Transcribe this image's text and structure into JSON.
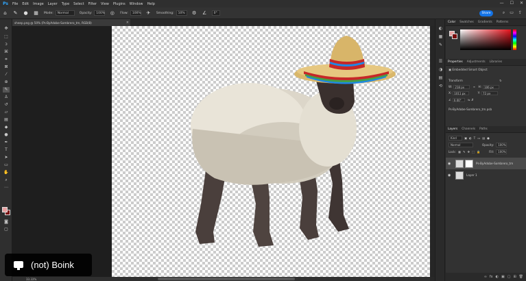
{
  "menubar": {
    "logo": "Ps",
    "items": [
      "File",
      "Edit",
      "Image",
      "Layer",
      "Type",
      "Select",
      "Filter",
      "View",
      "Plugins",
      "Window",
      "Help"
    ],
    "window_controls": [
      "—",
      "☐",
      "✕"
    ]
  },
  "options": {
    "mode_label": "Mode:",
    "mode_value": "Normal",
    "opacity_label": "Opacity:",
    "opacity_value": "100%",
    "flow_label": "Flow:",
    "flow_value": "100%",
    "smoothing_label": "Smoothing:",
    "smoothing_value": "10%",
    "angle_value": "0°",
    "share_label": "Share"
  },
  "document": {
    "tab_title": "sheep.png @ 50% (Ps-ByAdobe-Sombrero_tm, RGB/8)",
    "status_zoom": "33.33%"
  },
  "panels": {
    "color_tabs": [
      "Color",
      "Swatches",
      "Gradients",
      "Patterns"
    ],
    "properties_tabs": [
      "Properties",
      "Adjustments",
      "Libraries"
    ],
    "props_title": "Embedded Smart Object",
    "transform_label": "Transform",
    "w_label": "W:",
    "w_value": "218 px",
    "h_label": "H:",
    "h_value": "106 px",
    "x_label": "X:",
    "x_value": "1011 px",
    "y_label": "Y:",
    "y_value": "72 px",
    "angle_value": "0.00°",
    "file_name": "Ps-ByAdobe-Sombrero_tm.psb",
    "layers_tabs": [
      "Layers",
      "Channels",
      "Paths"
    ],
    "kind_value": "Kind",
    "blend_mode": "Normal",
    "opacity_label": "Opacity:",
    "opacity_value": "100%",
    "lock_label": "Lock:",
    "fill_label": "Fill:",
    "fill_value": "100%",
    "layers": [
      {
        "name": "Ps-ByAdobe-Sombrero_tm"
      },
      {
        "name": "Layer 1"
      }
    ],
    "footer_icons": [
      "∞",
      "fx",
      "◐",
      "▣",
      "▢",
      "⊞",
      "🗑"
    ]
  },
  "caption": {
    "text": "(not) Boink"
  },
  "colors": {
    "foreground": "#e8a0a0",
    "background": "#7a0b0b",
    "accent": "#1473e6"
  }
}
